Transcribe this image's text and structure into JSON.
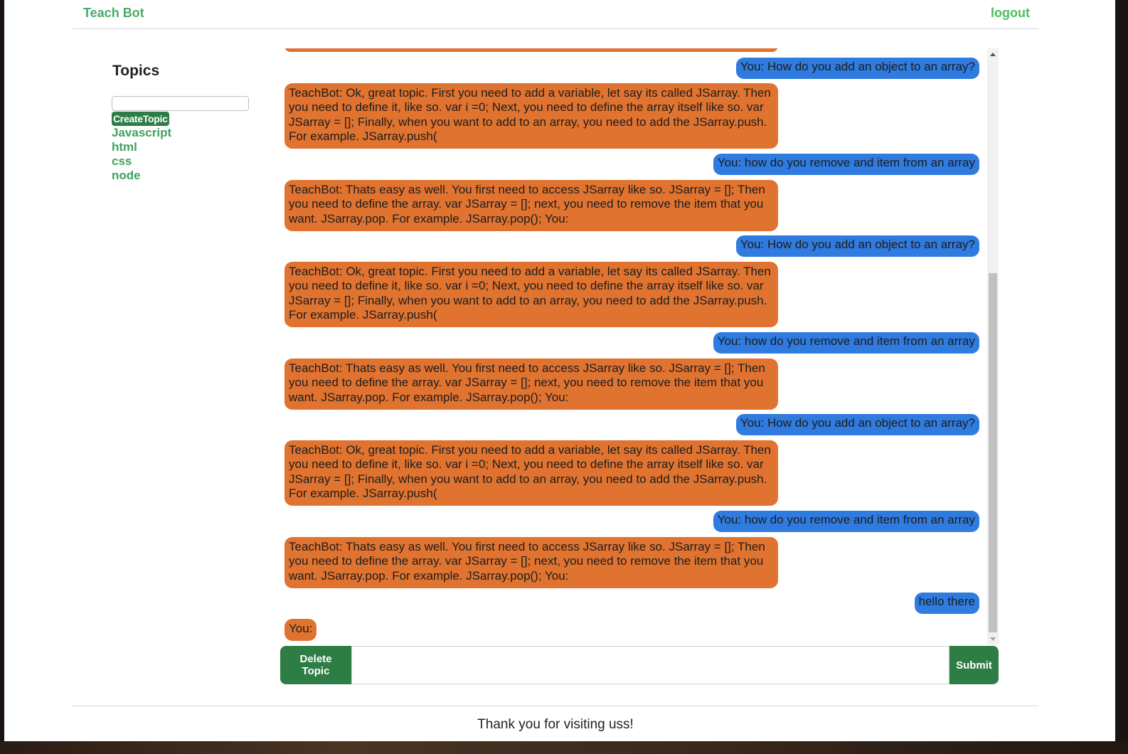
{
  "header": {
    "brand": "Teach Bot",
    "logout": "logout"
  },
  "sidebar": {
    "title": "Topics",
    "input_value": "",
    "create_label": "CreateTopic",
    "topics": [
      "Javascript",
      "html",
      "css",
      "node"
    ]
  },
  "chat": {
    "messages": [
      {
        "role": "bot",
        "text": ""
      },
      {
        "role": "user",
        "text": "You: How do you add an object to an array?"
      },
      {
        "role": "bot",
        "text": "TeachBot: Ok, great topic. First you need to add a variable, let say its called JSarray. Then you need to define it, like so. var i =0; Next, you need to define the array itself like so. var JSarray = []; Finally, when you want to add to an array, you need to add the JSarray.push. For example. JSarray.push("
      },
      {
        "role": "user",
        "text": "You: how do you remove and item from an array"
      },
      {
        "role": "bot",
        "text": "TeachBot: Thats easy as well. You first need to access JSarray like so. JSarray = []; Then you need to define the array. var JSarray = []; next, you need to remove the item that you want. JSarray.pop. For example. JSarray.pop(); You:"
      },
      {
        "role": "user",
        "text": "You: How do you add an object to an array?"
      },
      {
        "role": "bot",
        "text": "TeachBot: Ok, great topic. First you need to add a variable, let say its called JSarray. Then you need to define it, like so. var i =0; Next, you need to define the array itself like so. var JSarray = []; Finally, when you want to add to an array, you need to add the JSarray.push. For example. JSarray.push("
      },
      {
        "role": "user",
        "text": "You: how do you remove and item from an array"
      },
      {
        "role": "bot",
        "text": "TeachBot: Thats easy as well. You first need to access JSarray like so. JSarray = []; Then you need to define the array. var JSarray = []; next, you need to remove the item that you want. JSarray.pop. For example. JSarray.pop(); You:"
      },
      {
        "role": "user",
        "text": "You: How do you add an object to an array?"
      },
      {
        "role": "bot",
        "text": "TeachBot: Ok, great topic. First you need to add a variable, let say its called JSarray. Then you need to define it, like so. var i =0; Next, you need to define the array itself like so. var JSarray = []; Finally, when you want to add to an array, you need to add the JSarray.push. For example. JSarray.push("
      },
      {
        "role": "user",
        "text": "You: how do you remove and item from an array"
      },
      {
        "role": "bot",
        "text": "TeachBot: Thats easy as well. You first need to access JSarray like so. JSarray = []; Then you need to define the array. var JSarray = []; next, you need to remove the item that you want. JSarray.pop. For example. JSarray.pop(); You:"
      },
      {
        "role": "user",
        "text": "hello there"
      },
      {
        "role": "bot",
        "text": "You:"
      }
    ]
  },
  "composer": {
    "delete_label": "Delete Topic",
    "input_value": "",
    "submit_label": "Submit"
  },
  "footer": {
    "text": "Thank you for visiting uss!"
  },
  "colors": {
    "bot_bubble": "#e07330",
    "user_bubble": "#2f7be0",
    "button_green": "#2e7d45",
    "link_green": "#3fa060"
  }
}
